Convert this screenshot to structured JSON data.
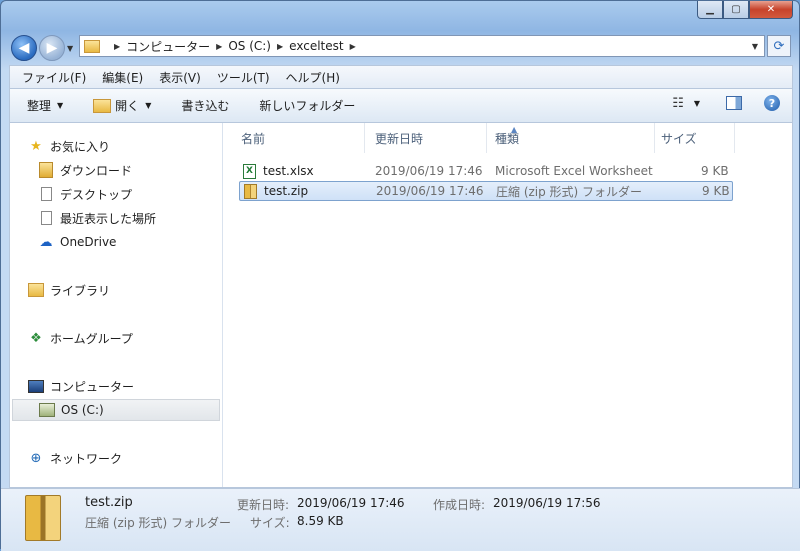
{
  "window": {
    "caption_buttons": [
      "▁",
      "▢",
      "✕"
    ]
  },
  "address": {
    "crumbs": [
      "コンピューター",
      "OS (C:)",
      "exceltest"
    ]
  },
  "menu": [
    "ファイル(F)",
    "編集(E)",
    "表示(V)",
    "ツール(T)",
    "ヘルプ(H)"
  ],
  "toolbar": {
    "organize": "整理",
    "open": "開く",
    "burn": "書き込む",
    "new_folder": "新しいフォルダー"
  },
  "sidebar": {
    "favorites": "お気に入り",
    "downloads": "ダウンロード",
    "desktop": "デスクトップ",
    "recent": "最近表示した場所",
    "onedrive": "OneDrive",
    "libraries": "ライブラリ",
    "homegroup": "ホームグループ",
    "computer": "コンピューター",
    "drive": "OS (C:)",
    "network": "ネットワーク"
  },
  "columns": {
    "name": "名前",
    "modified": "更新日時",
    "type": "種類",
    "size": "サイズ"
  },
  "files": [
    {
      "name": "test.xlsx",
      "modified": "2019/06/19 17:46",
      "type": "Microsoft Excel Worksheet",
      "size": "9 KB",
      "icon": "excel-file-icon"
    },
    {
      "name": "test.zip",
      "modified": "2019/06/19 17:46",
      "type": "圧縮 (zip 形式) フォルダー",
      "size": "9 KB",
      "icon": "zip-folder-icon"
    }
  ],
  "details": {
    "name": "test.zip",
    "type": "圧縮 (zip 形式) フォルダー",
    "modified_label": "更新日時:",
    "modified_value": "2019/06/19 17:46",
    "created_label": "作成日時:",
    "created_value": "2019/06/19 17:56",
    "size_label": "サイズ:",
    "size_value": "8.59 KB"
  }
}
